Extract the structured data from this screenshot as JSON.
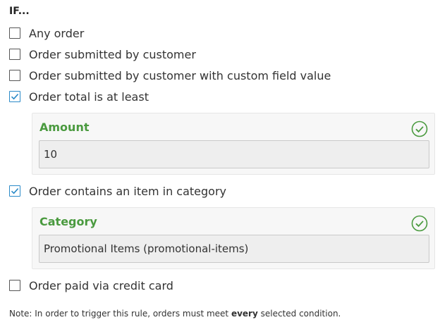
{
  "heading": "IF...",
  "conditions": [
    {
      "label": "Any order",
      "checked": false
    },
    {
      "label": "Order submitted by customer",
      "checked": false
    },
    {
      "label": "Order submitted by customer with custom field value",
      "checked": false
    },
    {
      "label": "Order total is at least",
      "checked": true
    },
    {
      "label": "Order contains an item in category",
      "checked": true
    },
    {
      "label": "Order paid via credit card",
      "checked": false
    }
  ],
  "amount_panel": {
    "label": "Amount",
    "value": "10",
    "status_icon": "check-circle-icon"
  },
  "category_panel": {
    "label": "Category",
    "value": "Promotional Items (promotional-items)",
    "status_icon": "check-circle-icon"
  },
  "note": {
    "prefix": "Note: In order to trigger this rule, orders must meet ",
    "emphasis": "every",
    "suffix": " selected condition."
  },
  "colors": {
    "accent_blue": "#2b8ac8",
    "valid_green": "#4a9a3f"
  }
}
